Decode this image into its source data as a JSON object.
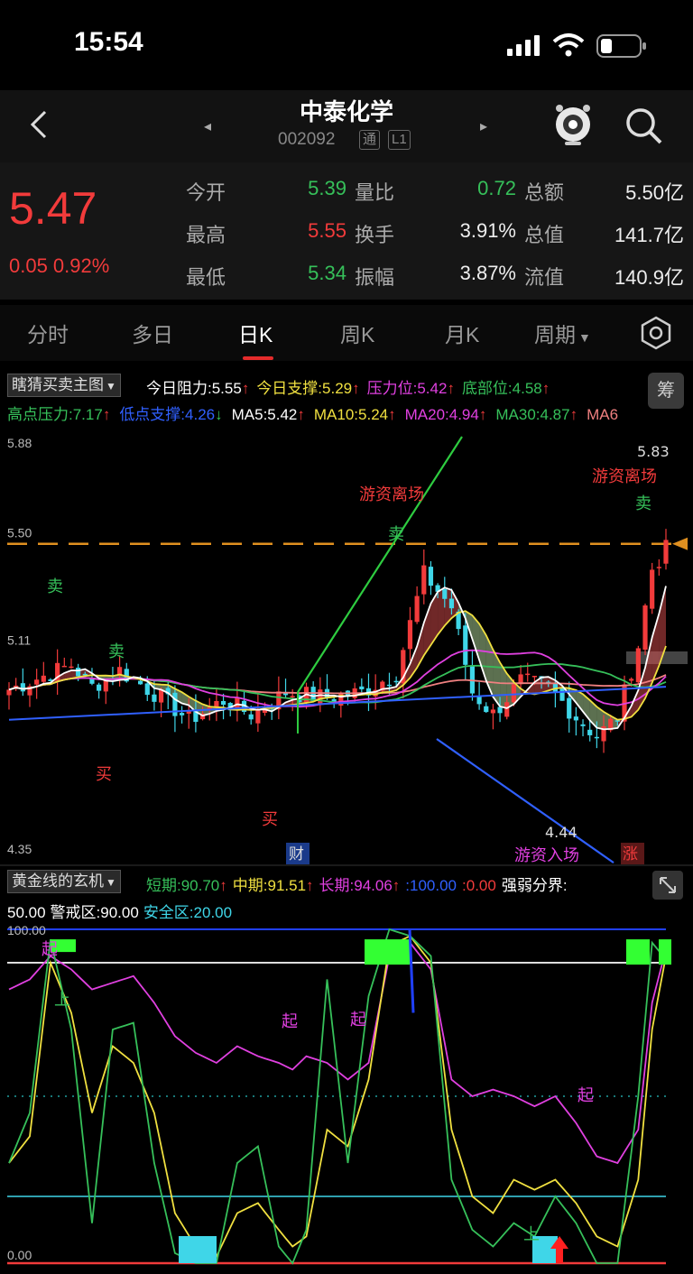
{
  "status_bar": {
    "time": "15:54"
  },
  "header": {
    "title": "中泰化学",
    "code": "002092",
    "tag1": "通",
    "tag2": "L1",
    "prev": "◂",
    "next": "▸"
  },
  "quote": {
    "price": "5.47",
    "change": "0.05 0.92%",
    "rows": [
      [
        {
          "label": "今开",
          "value": "5.39",
          "color": "green"
        },
        {
          "label": "量比",
          "value": "0.72",
          "color": "green"
        },
        {
          "label": "总额",
          "value": "5.50亿",
          "color": "white"
        }
      ],
      [
        {
          "label": "最高",
          "value": "5.55",
          "color": "red"
        },
        {
          "label": "换手",
          "value": "3.91%",
          "color": "white"
        },
        {
          "label": "总值",
          "value": "141.7亿",
          "color": "white"
        }
      ],
      [
        {
          "label": "最低",
          "value": "5.34",
          "color": "green"
        },
        {
          "label": "振幅",
          "value": "3.87%",
          "color": "white"
        },
        {
          "label": "流值",
          "value": "140.9亿",
          "color": "white"
        }
      ]
    ]
  },
  "tabs": [
    "分时",
    "多日",
    "日K",
    "周K",
    "月K",
    "周期"
  ],
  "active_tab": "日K",
  "indicator_main": {
    "selector": "瞎猜买卖主图",
    "chip": "筹",
    "line1": [
      {
        "text": "今日阻力:5.55",
        "color": "#ffffff",
        "arrow": "↑",
        "arrow_color": "#f23b3b"
      },
      {
        "text": "今日支撑:5.29",
        "color": "#f0e040",
        "arrow": "↑",
        "arrow_color": "#f23b3b"
      },
      {
        "text": "压力位:5.42",
        "color": "#e040e0",
        "arrow": "↑",
        "arrow_color": "#f23b3b"
      },
      {
        "text": "底部位:4.58",
        "color": "#36c05a",
        "arrow": "↑",
        "arrow_color": "#f23b3b"
      }
    ],
    "line2": [
      {
        "text": "高点压力:7.17",
        "color": "#36c05a",
        "arrow": "↑",
        "arrow_color": "#f23b3b"
      },
      {
        "text": "低点支撑:4.26",
        "color": "#3060ff",
        "arrow": "↓",
        "arrow_color": "#36c05a"
      },
      {
        "text": "MA5:5.42",
        "color": "#ffffff",
        "arrow": "↑",
        "arrow_color": "#f23b3b"
      },
      {
        "text": "MA10:5.24",
        "color": "#f0e040",
        "arrow": "↑",
        "arrow_color": "#f23b3b"
      },
      {
        "text": "MA20:4.94",
        "color": "#e040e0",
        "arrow": "↑",
        "arrow_color": "#f23b3b"
      },
      {
        "text": "MA30:4.87",
        "color": "#36c05a",
        "arrow": "↑",
        "arrow_color": "#f23b3b"
      },
      {
        "text": "MA6",
        "color": "#f08080",
        "arrow": "",
        "arrow_color": ""
      }
    ]
  },
  "main_chart": {
    "y_labels": [
      "5.88",
      "5.50",
      "5.11",
      "4.35"
    ],
    "ref_price": 5.49,
    "high_label": "5.83",
    "low_label": "4.44",
    "annotations": {
      "sell": "卖",
      "buy": "买",
      "flee": "游资离场",
      "enter": "游资入场",
      "cai": "财",
      "zhang": "涨"
    }
  },
  "indicator_sub": {
    "selector": "黄金线的玄机",
    "line1": [
      {
        "text": "短期:90.70",
        "color": "#36c05a",
        "arrow": "↑"
      },
      {
        "text": "中期:91.51",
        "color": "#f0e040",
        "arrow": "↑"
      },
      {
        "text": "长期:94.06",
        "color": "#e040e0",
        "arrow": "↑"
      },
      {
        "text": ":100.00",
        "color": "#3060ff",
        "arrow": ""
      },
      {
        "text": ":0.00",
        "color": "#f23b3b",
        "arrow": ""
      },
      {
        "text": "强弱分界:",
        "color": "#ffffff",
        "arrow": ""
      }
    ],
    "line2": [
      {
        "text": "50.00",
        "color": "#ffffff"
      },
      {
        "text": "警戒区:90.00",
        "color": "#ffffff"
      },
      {
        "text": "安全区:20.00",
        "color": "#3fd6e8"
      }
    ],
    "y_labels": [
      "100.00",
      "0.00"
    ],
    "marks": {
      "qi": "起",
      "shang": "上"
    }
  },
  "colors": {
    "up": "#f23b3b",
    "down": "#36c05a",
    "ma5": "#ffffff",
    "ma10": "#f0e040",
    "ma20": "#e040e0",
    "ma30": "#36c05a",
    "ma60": "#f08080",
    "low_support": "#3060ff",
    "ref_line": "#e09020"
  }
}
